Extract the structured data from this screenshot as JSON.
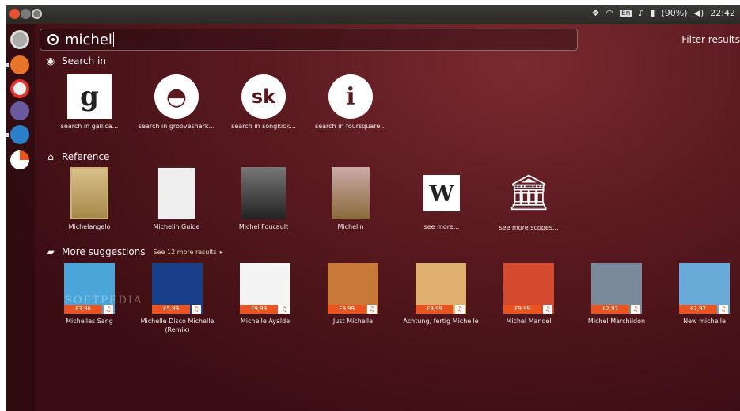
{
  "top_panel": {
    "battery": "(90%)",
    "language": "En",
    "clock": "22:42"
  },
  "search": {
    "query": "michel",
    "filter_label": "Filter results"
  },
  "sections": {
    "search_in": {
      "title": "Search in",
      "items": [
        {
          "label": "search in gallica...",
          "icon": "gallica-icon"
        },
        {
          "label": "search in grooveshark...",
          "icon": "grooveshark-icon"
        },
        {
          "label": "search in songkick...",
          "icon": "songkick-icon"
        },
        {
          "label": "search in foursquare...",
          "icon": "foursquare-icon"
        }
      ]
    },
    "reference": {
      "title": "Reference",
      "items": [
        {
          "label": "Michelangelo"
        },
        {
          "label": "Michelin Guide"
        },
        {
          "label": "Michel Foucault"
        },
        {
          "label": "Michelin"
        },
        {
          "label": "see more..."
        },
        {
          "label": "see more scopes..."
        }
      ]
    },
    "more_suggestions": {
      "title": "More suggestions",
      "see_more": "See 12 more results",
      "items": [
        {
          "label": "Michelles Sang",
          "price": "£3,96",
          "color": "#4aa6d8"
        },
        {
          "label": "Michelle Disco Michelle (Remix)",
          "price": "£5,99",
          "color": "#1a3f8a"
        },
        {
          "label": "Michelle Ayalde",
          "price": "£9,99",
          "color": "#f4f4f4"
        },
        {
          "label": "Just Michelle",
          "price": "£9,99",
          "color": "#c87838"
        },
        {
          "label": "Achtung, fertig Michelle",
          "price": "£9,99",
          "color": "#e0b070"
        },
        {
          "label": "Michel Mandel",
          "price": "£9,99",
          "color": "#d44a2e"
        },
        {
          "label": "Michel Marchildon",
          "price": "£2,97",
          "color": "#7a8a9a"
        },
        {
          "label": "New michelle",
          "price": "£2,97",
          "color": "#6aaad8"
        }
      ]
    }
  },
  "watermark": "SOFTPEDIA",
  "colors": {
    "accent": "#e95420",
    "background": "#5a1a20"
  }
}
